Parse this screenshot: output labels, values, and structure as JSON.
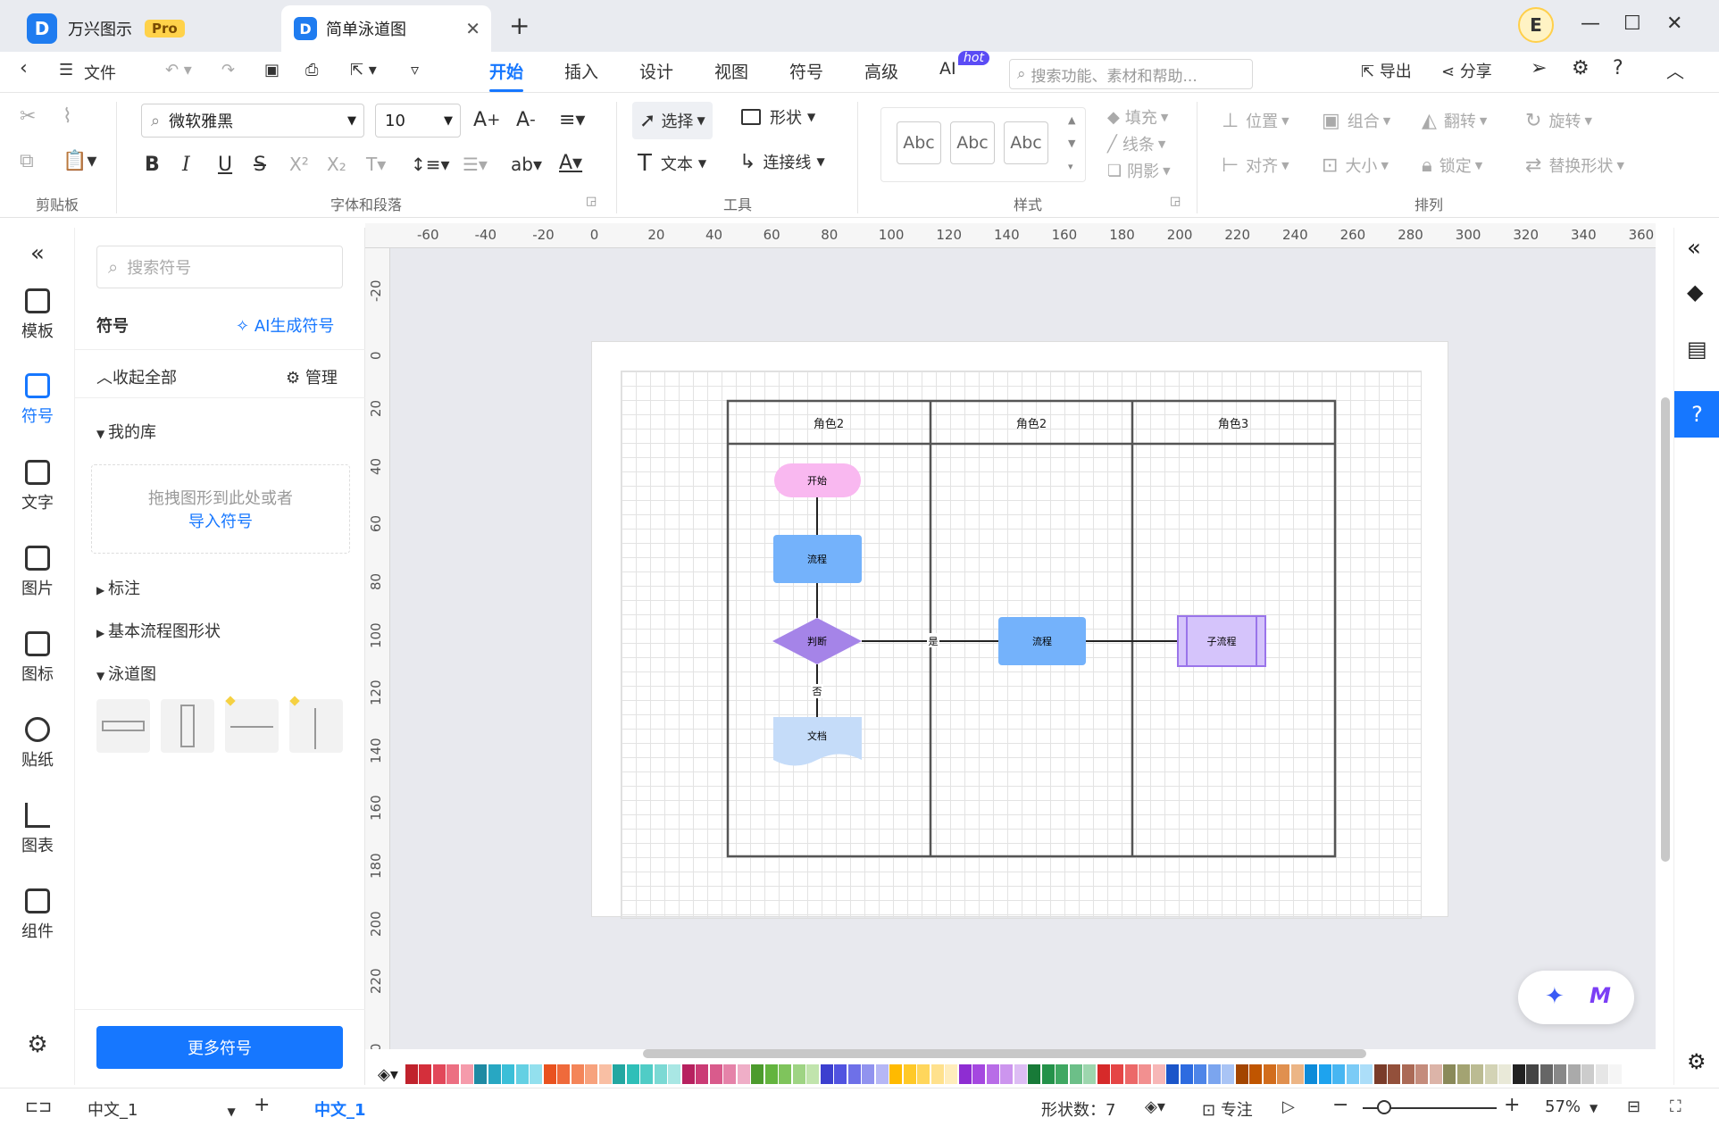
{
  "app": {
    "name": "万兴图示",
    "badge": "Pro",
    "doc_tab": "简单泳道图",
    "avatar": "E"
  },
  "menu": {
    "file": "文件",
    "tabs": [
      "开始",
      "插入",
      "设计",
      "视图",
      "符号",
      "高级",
      "AI"
    ],
    "hot_badge": "hot",
    "search_placeholder": "搜索功能、素材和帮助...",
    "export": "导出",
    "share": "分享"
  },
  "ribbon": {
    "font_family": "微软雅黑",
    "font_size": "10",
    "select": "选择",
    "shape": "形状",
    "text": "文本",
    "connector": "连接线",
    "style_sample": "Abc",
    "fill": "填充",
    "line": "线条",
    "shadow": "阴影",
    "position": "位置",
    "group": "组合",
    "flip": "翻转",
    "rotate": "旋转",
    "align": "对齐",
    "size": "大小",
    "lock": "锁定",
    "replace": "替换形状",
    "groups": [
      "剪贴板",
      "字体和段落",
      "工具",
      "样式",
      "排列"
    ]
  },
  "leftbar": [
    "模板",
    "符号",
    "文字",
    "图片",
    "图标",
    "贴纸",
    "图表",
    "组件"
  ],
  "symbol_panel": {
    "search_placeholder": "搜索符号",
    "title": "符号",
    "ai_generate": "AI生成符号",
    "collapse_all": "收起全部",
    "manage": "管理",
    "my_library": "我的库",
    "drop_hint": "拖拽图形到此处或者",
    "import": "导入符号",
    "categories": [
      "标注",
      "基本流程图形状",
      "泳道图"
    ],
    "more": "更多符号"
  },
  "ruler": {
    "h": [
      "-60",
      "-40",
      "-20",
      "0",
      "20",
      "40",
      "60",
      "80",
      "100",
      "120",
      "140",
      "160",
      "180",
      "200",
      "220",
      "240",
      "260",
      "280",
      "300",
      "320",
      "340",
      "360"
    ],
    "v": [
      "-20",
      "0",
      "20",
      "40",
      "60",
      "80",
      "100",
      "120",
      "140",
      "160",
      "180",
      "200",
      "220",
      "0"
    ]
  },
  "diagram": {
    "lanes": [
      "角色2",
      "角色2",
      "角色3"
    ],
    "start": "开始",
    "process1": "流程",
    "decision": "判断",
    "doc": "文档",
    "process2": "流程",
    "subprocess": "子流程",
    "yes": "是",
    "no": "否",
    "colors": {
      "start": "#f9b8f0",
      "process": "#74b2fb",
      "decision": "#a584e8",
      "doc": "#c5dcf9",
      "subprocess": "#d5c4fb"
    }
  },
  "palette": [
    "#c0222c",
    "#d42f3b",
    "#e2485a",
    "#ec6f82",
    "#f59bab",
    "#1e8aa3",
    "#28a7c2",
    "#3bbfd8",
    "#64d0e3",
    "#93e0ee",
    "#e9521f",
    "#ef6a3b",
    "#f48559",
    "#f7a27d",
    "#f9bfa4",
    "#23a7a1",
    "#2fbfb8",
    "#50ccc6",
    "#7bd9d4",
    "#a9e7e4",
    "#b7215f",
    "#cb3b75",
    "#d95b8c",
    "#e583a9",
    "#efaec7",
    "#4c9b2d",
    "#63b43e",
    "#7fc45c",
    "#9fd484",
    "#c1e4ad",
    "#3c3fcf",
    "#5153e0",
    "#6e70e8",
    "#9193ef",
    "#b6b7f5",
    "#ffba00",
    "#ffc928",
    "#ffd65c",
    "#ffe18d",
    "#ffedbc",
    "#8e2dd2",
    "#a548e0",
    "#b86ce7",
    "#cc95ee",
    "#ddbdf4",
    "#187a38",
    "#24924a",
    "#3fa862",
    "#6cbf88",
    "#9dd6ae",
    "#d62a2a",
    "#e54545",
    "#ec6868",
    "#f29090",
    "#f7b7b7",
    "#1b55c9",
    "#2d6be0",
    "#4e85e8",
    "#7ba5ef",
    "#a9c4f5",
    "#a34500",
    "#c05500",
    "#d26d1d",
    "#e0904f",
    "#ecb585",
    "#0d8bd9",
    "#1ea3ee",
    "#47b6f2",
    "#7bcbf6",
    "#acdef9",
    "#7a3c2a",
    "#93503b",
    "#ab6a56",
    "#c48c7c",
    "#dcb4a8",
    "#8a8a5a",
    "#a3a372",
    "#bbbb92",
    "#d3d3b5",
    "#e9e9d8",
    "#222222",
    "#444444",
    "#666666",
    "#888888",
    "#aaaaaa",
    "#cccccc",
    "#e6e6e6",
    "#f5f5f5"
  ],
  "status": {
    "page": "中文_1",
    "page_tab": "中文_1",
    "shape_count": "形状数：7",
    "focus": "专注",
    "zoom": "57%"
  }
}
